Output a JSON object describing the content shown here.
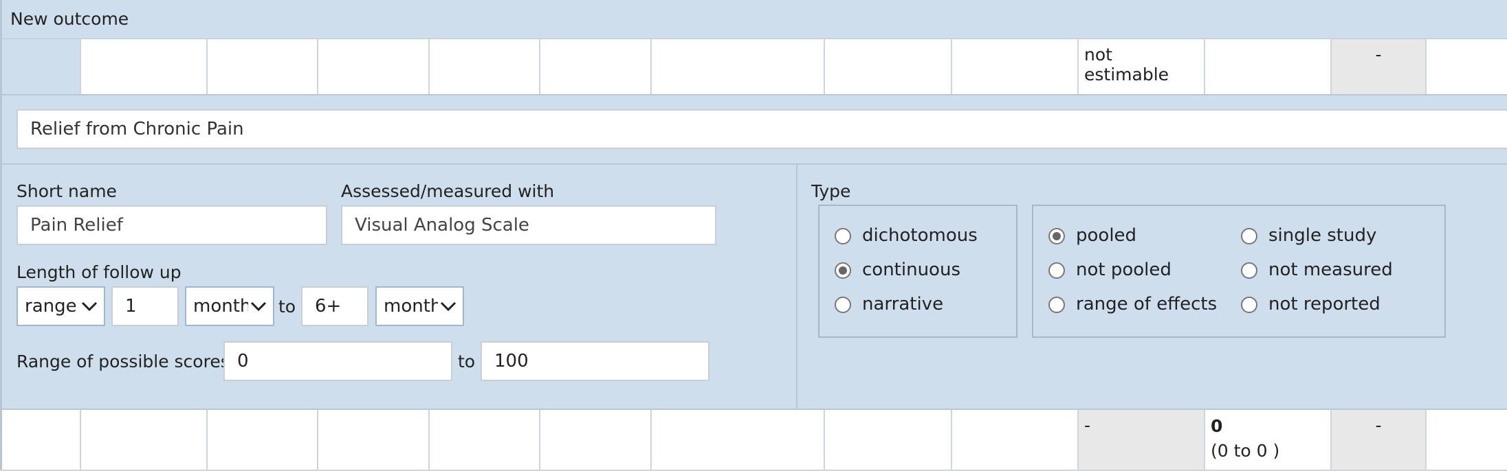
{
  "header": {
    "title": "New outcome"
  },
  "top_row": {
    "estimate": "not estimable",
    "dash": "-"
  },
  "outcome_name": {
    "value": "Relief from Chronic Pain"
  },
  "short_name": {
    "label": "Short name",
    "value": "Pain Relief"
  },
  "assessed": {
    "label": "Assessed/measured with",
    "value": "Visual Analog Scale"
  },
  "follow_up": {
    "label": "Length of follow up",
    "mode": "range",
    "from_value": "1",
    "from_unit": "months",
    "to_label": "to",
    "to_value": "6+",
    "to_unit": "months"
  },
  "scores": {
    "label": "Range of possible scores",
    "min": "0",
    "to_label": "to",
    "max": "100"
  },
  "type": {
    "label": "Type",
    "options": [
      {
        "label": "dichotomous",
        "selected": false
      },
      {
        "label": "continuous",
        "selected": true
      },
      {
        "label": "narrative",
        "selected": false
      }
    ]
  },
  "pooling": {
    "options": [
      {
        "label": "pooled",
        "selected": true
      },
      {
        "label": "not pooled",
        "selected": false
      },
      {
        "label": "range of effects",
        "selected": false
      },
      {
        "label": "single study",
        "selected": false
      },
      {
        "label": "not measured",
        "selected": false
      },
      {
        "label": "not reported",
        "selected": false
      }
    ]
  },
  "bottom_row": {
    "dash_left": "-",
    "effect_value": "0",
    "effect_range": "(0 to 0 )",
    "dash_right": "-"
  }
}
